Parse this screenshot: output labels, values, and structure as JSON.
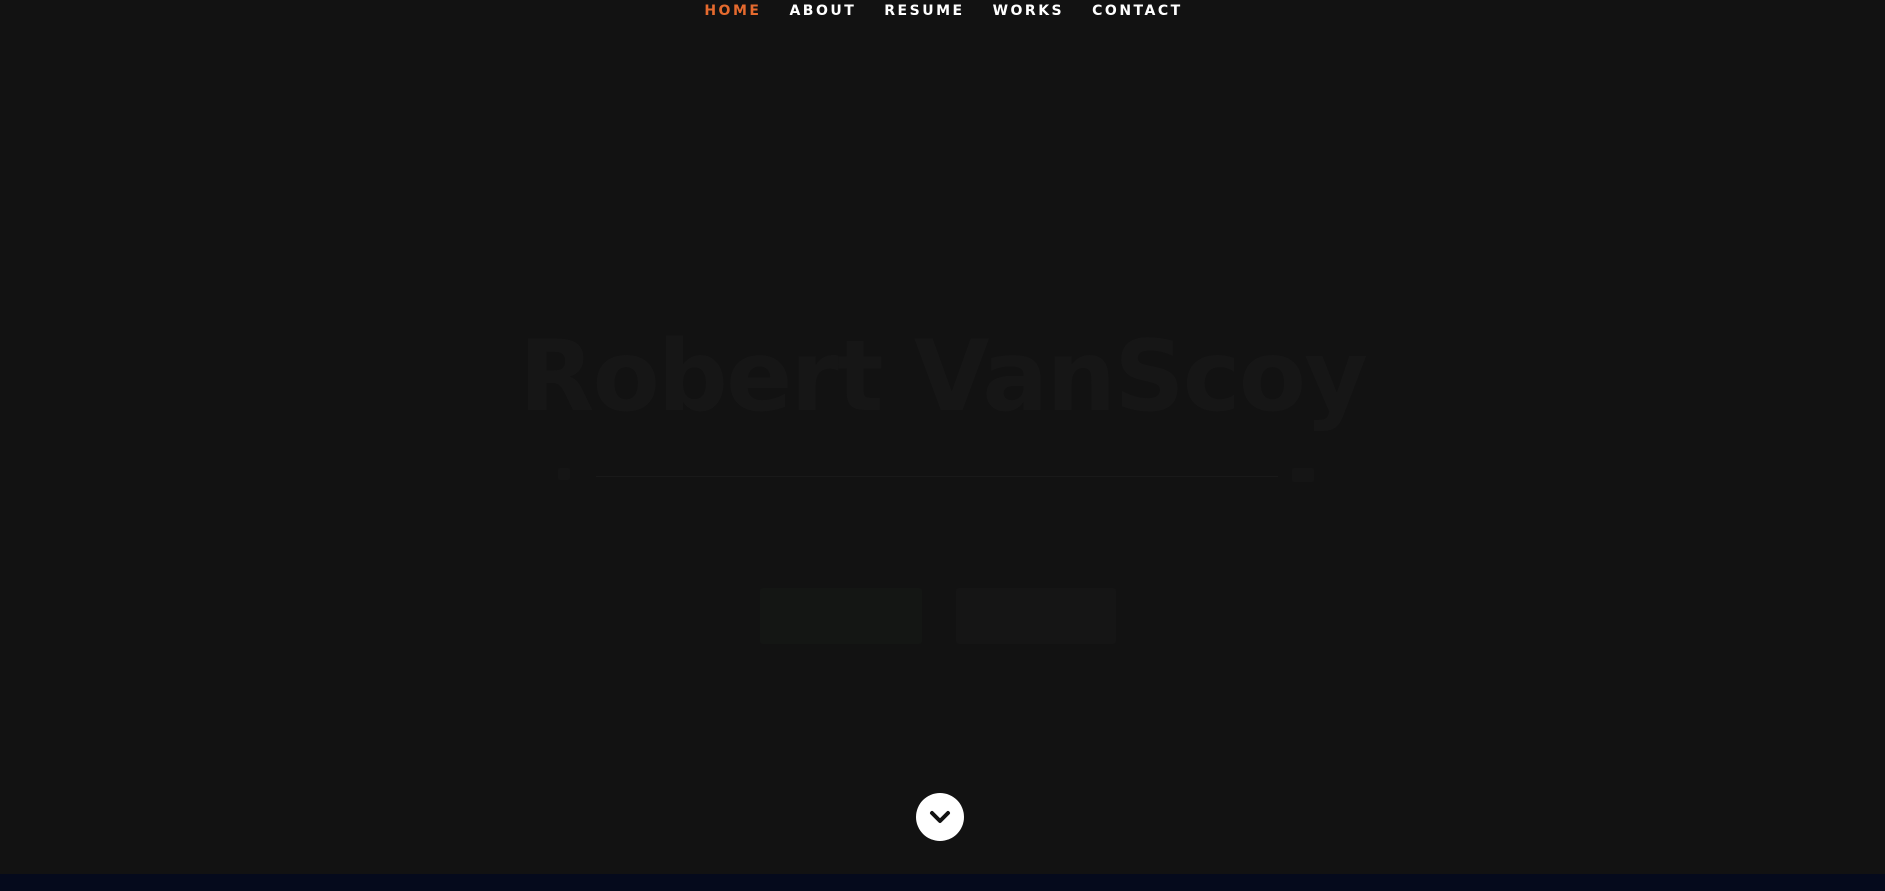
{
  "nav": {
    "items": [
      {
        "label": "HOME",
        "active": true
      },
      {
        "label": "ABOUT",
        "active": false
      },
      {
        "label": "RESUME",
        "active": false
      },
      {
        "label": "WORKS",
        "active": false
      },
      {
        "label": "CONTACT",
        "active": false
      }
    ],
    "active_color": "#e56a2e"
  },
  "hero": {
    "title": "Robert VanScoy"
  },
  "colors": {
    "background": "#121212",
    "footer_strip": "#050a1c",
    "scroll_button": "#ffffff"
  },
  "icons": {
    "scroll_down": "chevron-down-icon"
  }
}
